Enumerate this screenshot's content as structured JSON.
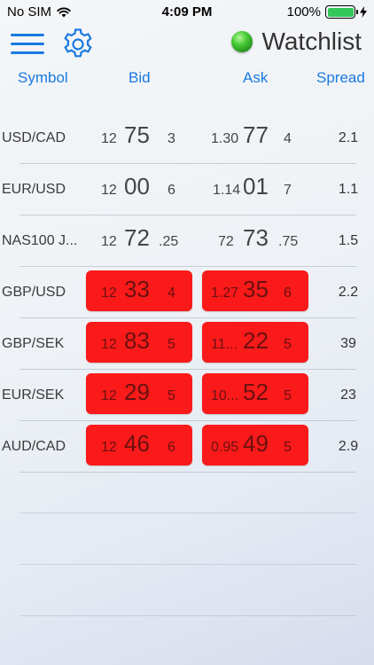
{
  "status_bar": {
    "carrier": "No SIM",
    "time": "4:09 PM",
    "battery": "100%"
  },
  "nav": {
    "title": "Watchlist",
    "connection_color": "#3cc42c"
  },
  "columns": {
    "symbol": "Symbol",
    "bid": "Bid",
    "ask": "Ask",
    "spread": "Spread"
  },
  "colors": {
    "accent": "#1a7ae0",
    "up": "#86c61b",
    "down": "#fb1a1a"
  },
  "rows": [
    {
      "symbol": "USD/CAD",
      "state": "up",
      "bid": {
        "pre": "12",
        "big": "75",
        "post": "3"
      },
      "ask": {
        "pre": "1.30",
        "big": "77",
        "post": "4"
      },
      "spread": "2.1"
    },
    {
      "symbol": "EUR/USD",
      "state": "none",
      "bid": {
        "pre": "12",
        "big": "00",
        "post": "6"
      },
      "ask": {
        "pre": "1.14",
        "big": "01",
        "post": "7"
      },
      "spread": "1.1"
    },
    {
      "symbol": "NAS100 J...",
      "state": "none",
      "bid": {
        "pre": "12",
        "big": "72",
        "post": ".25"
      },
      "ask": {
        "pre": "72",
        "big": "73",
        "post": ".75"
      },
      "spread": "1.5"
    },
    {
      "symbol": "GBP/USD",
      "state": "down",
      "bid": {
        "pre": "12",
        "big": "33",
        "post": "4"
      },
      "ask": {
        "pre": "1.27",
        "big": "35",
        "post": "6"
      },
      "spread": "2.2"
    },
    {
      "symbol": "GBP/SEK",
      "state": "down",
      "bid": {
        "pre": "12",
        "big": "83",
        "post": "5"
      },
      "ask": {
        "pre": "11...",
        "big": "22",
        "post": "5"
      },
      "spread": "39"
    },
    {
      "symbol": "EUR/SEK",
      "state": "down",
      "bid": {
        "pre": "12",
        "big": "29",
        "post": "5"
      },
      "ask": {
        "pre": "10...",
        "big": "52",
        "post": "5"
      },
      "spread": "23"
    },
    {
      "symbol": "AUD/CAD",
      "state": "down",
      "bid": {
        "pre": "12",
        "big": "46",
        "post": "6"
      },
      "ask": {
        "pre": "0.95",
        "big": "49",
        "post": "5"
      },
      "spread": "2.9"
    }
  ]
}
